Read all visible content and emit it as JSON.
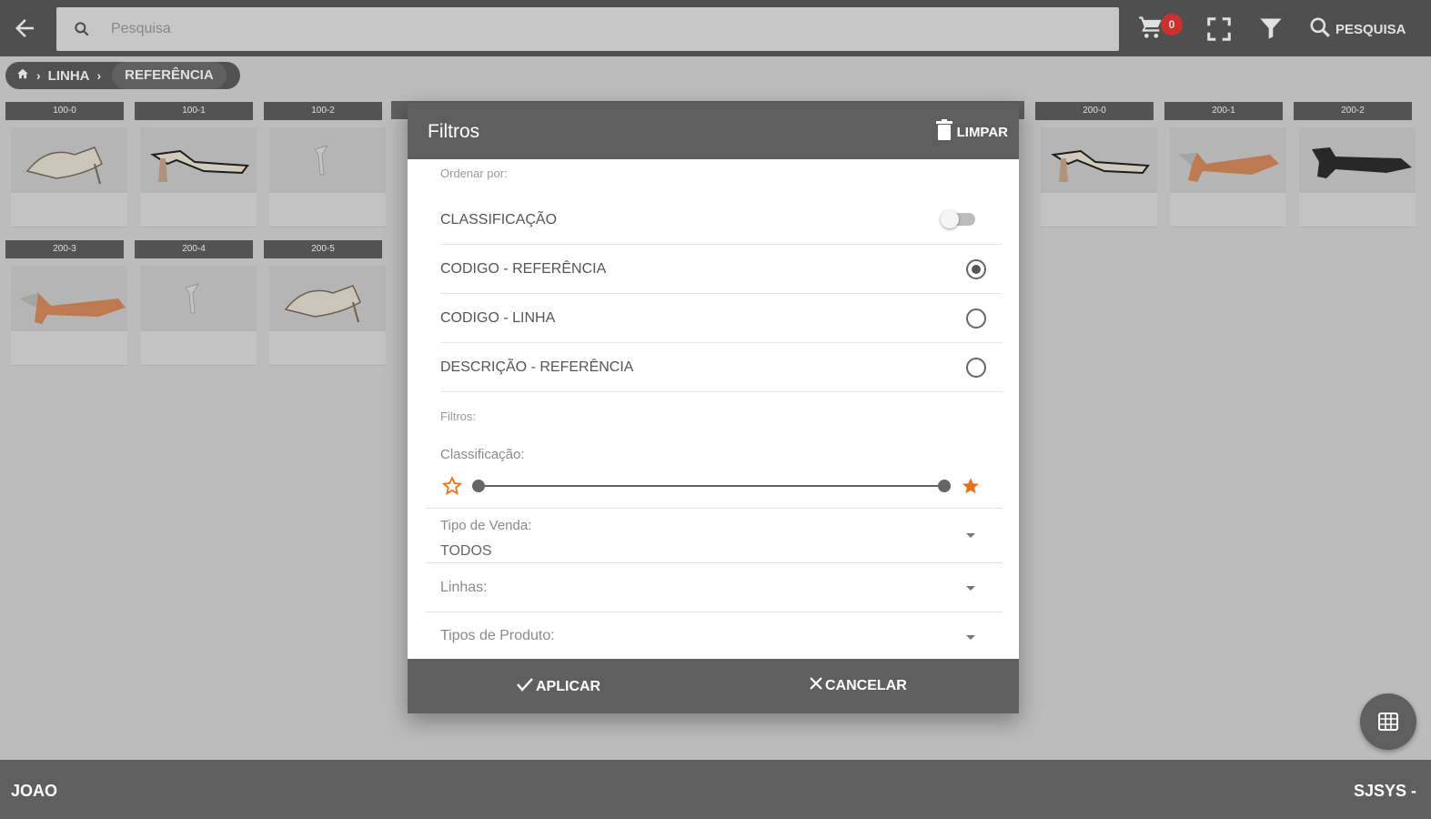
{
  "topbar": {
    "search_placeholder": "Pesquisa",
    "cart_badge": "0",
    "search_label": "PESQUISA"
  },
  "breadcrumb": {
    "items": [
      "LINHA",
      "REFERÊNCIA"
    ]
  },
  "cards": [
    {
      "tag": "100-0",
      "row": 0,
      "col": 0
    },
    {
      "tag": "100-1",
      "row": 0,
      "col": 1
    },
    {
      "tag": "100-2",
      "row": 0,
      "col": 2
    },
    {
      "tag": "200-0",
      "row": 0,
      "col": 8
    },
    {
      "tag": "200-1",
      "row": 0,
      "col": 9
    },
    {
      "tag": "200-2",
      "row": 0,
      "col": 10
    },
    {
      "tag": "200-3",
      "row": 1,
      "col": 0
    },
    {
      "tag": "200-4",
      "row": 1,
      "col": 1
    },
    {
      "tag": "200-5",
      "row": 1,
      "col": 2
    }
  ],
  "dialog": {
    "title": "Filtros",
    "clear_label": "LIMPAR",
    "sort_section_label": "Ordenar por:",
    "sort_options": [
      {
        "label": "CLASSIFICAÇÃO",
        "control": "toggle",
        "on": false
      },
      {
        "label": "CODIGO - REFERÊNCIA",
        "control": "radio",
        "checked": true
      },
      {
        "label": "CODIGO - LINHA",
        "control": "radio",
        "checked": false
      },
      {
        "label": "DESCRIÇÃO - REFERÊNCIA",
        "control": "radio",
        "checked": false
      }
    ],
    "filters_section_label": "Filtros:",
    "classification_label": "Classificação:",
    "classification_range": [
      0,
      1
    ],
    "selects": [
      {
        "label": "Tipo de Venda:",
        "value": "TODOS"
      },
      {
        "label": "Linhas:",
        "value": ""
      },
      {
        "label": "Tipos de Produto:",
        "value": ""
      }
    ],
    "apply_label": "APLICAR",
    "cancel_label": "CANCELAR"
  },
  "bottombar": {
    "user": "JOAO",
    "brand": "SJSYS -"
  },
  "colors": {
    "header": "#5f5f5f",
    "star": "#e8721c",
    "badge": "#e53935"
  }
}
